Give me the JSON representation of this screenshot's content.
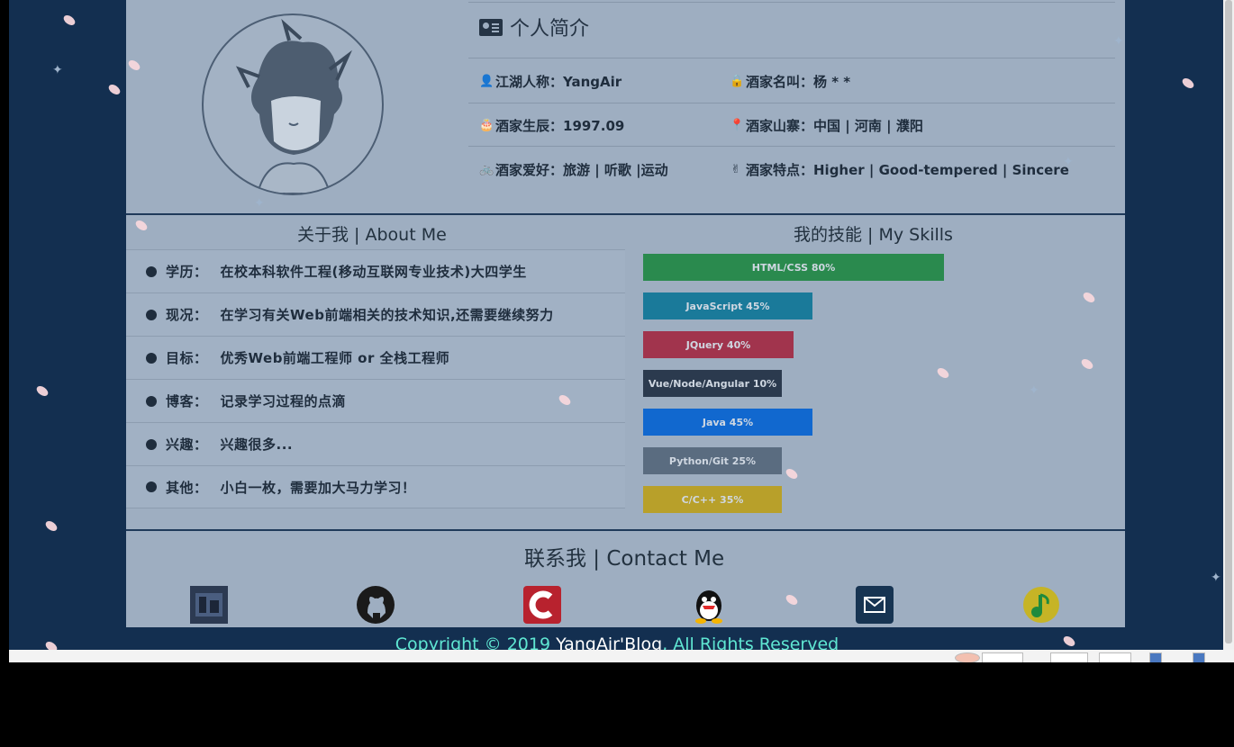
{
  "profile": {
    "title": "个人简介",
    "nickname": "江湖人称：YangAir",
    "realname": "酒家名叫：杨 * *",
    "birthday": "酒家生辰：1997.09",
    "hometown": "酒家山寨：中国 | 河南 | 濮阳",
    "hobby": "酒家爱好：旅游 | 听歌 |运动",
    "traits": "酒家特点：Higher | Good-tempered | Sincere"
  },
  "about": {
    "title": "关于我 | About Me",
    "items": [
      {
        "key": "学历：",
        "value": "在校本科软件工程(移动互联网专业技术)大四学生"
      },
      {
        "key": "现况：",
        "value": "在学习有关Web前端相关的技术知识,还需要继续努力"
      },
      {
        "key": "目标：",
        "value": "优秀Web前端工程师 or 全栈工程师"
      },
      {
        "key": "博客：",
        "value": "记录学习过程的点滴"
      },
      {
        "key": "兴趣：",
        "value": "兴趣很多..."
      },
      {
        "key": "其他：",
        "value": "小白一枚，需要加大马力学习！"
      }
    ]
  },
  "skills": {
    "title": "我的技能 | My Skills",
    "items": [
      {
        "label": "HTML/CSS     80%",
        "level": 0.8,
        "color": "#2a8a4e"
      },
      {
        "label": "JavaScript     45%",
        "level": 0.45,
        "color": "#1a7a9a"
      },
      {
        "label": "JQuery     40%",
        "level": 0.4,
        "color": "#a1344d"
      },
      {
        "label": "Vue/Node/Angular 10%",
        "level": 0.1,
        "color": "#2b3a4e"
      },
      {
        "label": "Java     45%",
        "level": 0.45,
        "color": "#1168cf"
      },
      {
        "label": "Python/Git  25%",
        "level": 0.25,
        "color": "#5a6c80"
      },
      {
        "label": "C/C++     35%",
        "level": 0.35,
        "color": "#b8a02a"
      }
    ]
  },
  "contact": {
    "title": "联系我 | Contact Me",
    "icons": [
      "blog-icon",
      "github-icon",
      "csdn-icon",
      "qq-icon",
      "email-icon",
      "music-icon"
    ]
  },
  "footer": {
    "copyright_prefix": "Copyright © 2019 ",
    "brand": "YangAir'Blog",
    "copyright_suffix": ", All Rights Reserved"
  }
}
